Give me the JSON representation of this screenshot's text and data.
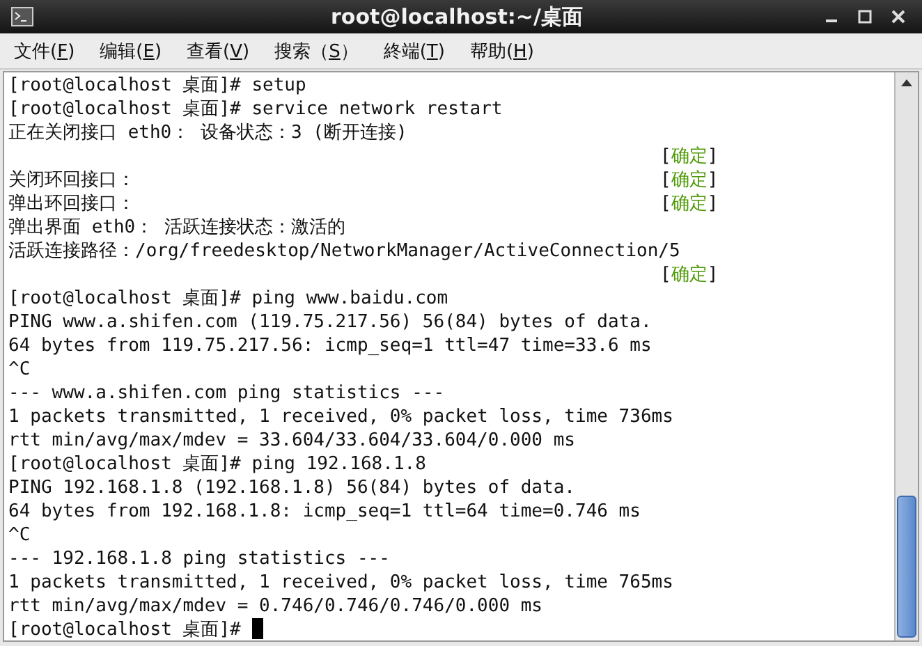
{
  "window": {
    "title": "root@localhost:~/桌面"
  },
  "menu": [
    {
      "pre": "文件(",
      "key": "F",
      "post": ")"
    },
    {
      "pre": "编辑(",
      "key": "E",
      "post": ")"
    },
    {
      "pre": "查看(",
      "key": "V",
      "post": ")"
    },
    {
      "pre": "搜索（",
      "key": "S",
      "post": "）"
    },
    {
      "pre": "終端(",
      "key": "T",
      "post": ")"
    },
    {
      "pre": "帮助(",
      "key": "H",
      "post": ")"
    }
  ],
  "terminal": {
    "cursor_visible": true,
    "lines": [
      {
        "text": "[root@localhost 桌面]# setup"
      },
      {
        "text": "[root@localhost 桌面]# service network restart"
      },
      {
        "text": "正在关闭接口 eth0： 设备状态：3 (断开连接)"
      },
      {
        "status": {
          "open": "[",
          "label": "确定",
          "close": "]"
        }
      },
      {
        "text": "关闭环回接口：",
        "status": {
          "open": "[",
          "label": "确定",
          "close": "]"
        }
      },
      {
        "text": "弹出环回接口：",
        "status": {
          "open": "[",
          "label": "确定",
          "close": "]"
        }
      },
      {
        "text": "弹出界面 eth0： 活跃连接状态：激活的"
      },
      {
        "text": "活跃连接路径：/org/freedesktop/NetworkManager/ActiveConnection/5"
      },
      {
        "status": {
          "open": "[",
          "label": "确定",
          "close": "]"
        }
      },
      {
        "text": "[root@localhost 桌面]# ping www.baidu.com"
      },
      {
        "text": "PING www.a.shifen.com (119.75.217.56) 56(84) bytes of data."
      },
      {
        "text": "64 bytes from 119.75.217.56: icmp_seq=1 ttl=47 time=33.6 ms"
      },
      {
        "text": "^C"
      },
      {
        "text": "--- www.a.shifen.com ping statistics ---"
      },
      {
        "text": "1 packets transmitted, 1 received, 0% packet loss, time 736ms"
      },
      {
        "text": "rtt min/avg/max/mdev = 33.604/33.604/33.604/0.000 ms"
      },
      {
        "text": "[root@localhost 桌面]# ping 192.168.1.8"
      },
      {
        "text": "PING 192.168.1.8 (192.168.1.8) 56(84) bytes of data."
      },
      {
        "text": "64 bytes from 192.168.1.8: icmp_seq=1 ttl=64 time=0.746 ms"
      },
      {
        "text": "^C"
      },
      {
        "text": "--- 192.168.1.8 ping statistics ---"
      },
      {
        "text": "1 packets transmitted, 1 received, 0% packet loss, time 765ms"
      },
      {
        "text": "rtt min/avg/max/mdev = 0.746/0.746/0.746/0.000 ms"
      },
      {
        "text": "[root@localhost 桌面]# "
      }
    ]
  }
}
